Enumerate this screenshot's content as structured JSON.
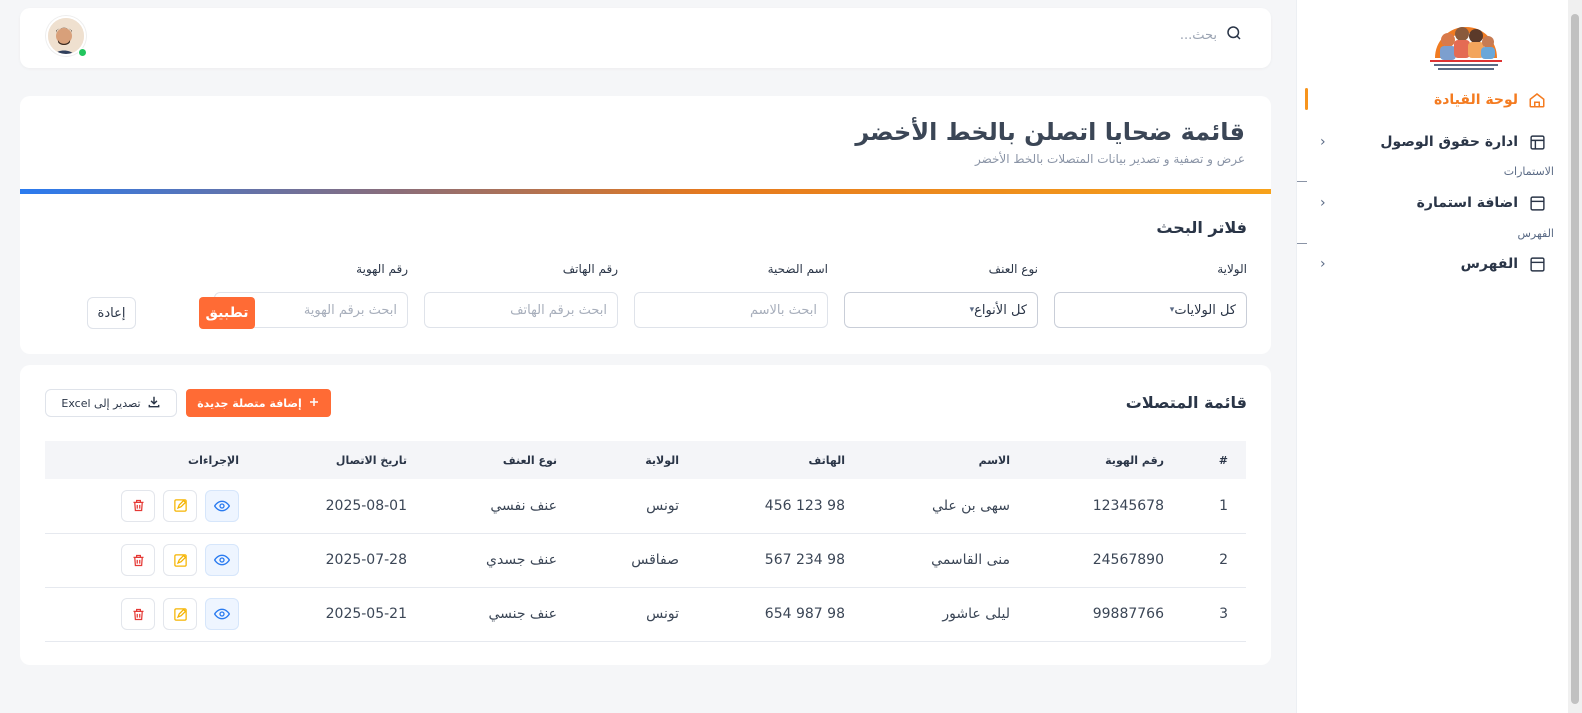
{
  "search": {
    "placeholder": "بحث..."
  },
  "sidebar": {
    "items": [
      {
        "label": "لوحة القيادة"
      },
      {
        "label": "ادارة حقوق الوصول"
      },
      {
        "label": "اضافة استمارة"
      },
      {
        "label": "الفهرس"
      }
    ],
    "captions": [
      "الاستمارات",
      "الفهرس"
    ]
  },
  "header": {
    "title": "قائمة ضحايا اتصلن بالخط الأخضر",
    "subtitle": "عرض و تصفية و تصدير بيانات المتصلات بالخط الأخضر"
  },
  "filters": {
    "title": "فلاتر البحث",
    "labels": {
      "state": "الولاية",
      "violence_type": "نوع العنف",
      "victim_name": "اسم الضحية",
      "phone": "رقم الهاتف",
      "id": "رقم الهوية"
    },
    "values": {
      "state": "كل الولايات",
      "violence_type": "كل الأنواع"
    },
    "placeholders": {
      "victim_name": "ابحث بالاسم",
      "phone": "ابحث برقم الهاتف",
      "id": "ابحث برقم الهوية"
    },
    "apply_label": "تطبيق",
    "reset_label": "إعادة"
  },
  "list": {
    "title": "قائمة المتصلات",
    "add_label": "إضافة متصلة جديدة",
    "export_label": "تصدير إلى Excel",
    "columns": [
      "#",
      "رقم الهوية",
      "الاسم",
      "الهاتف",
      "الولاية",
      "نوع العنف",
      "تاريخ الاتصال",
      "الإجراءات"
    ],
    "rows": [
      {
        "n": "1",
        "id": "12345678",
        "name": "سهى بن علي",
        "phone": "98 123 456",
        "state": "تونس",
        "type": "عنف نفسي",
        "date": "2025-08-01"
      },
      {
        "n": "2",
        "id": "24567890",
        "name": "منى القاسمي",
        "phone": "98 234 567",
        "state": "صفاقس",
        "type": "عنف جسدي",
        "date": "2025-07-28"
      },
      {
        "n": "3",
        "id": "99887766",
        "name": "ليلى عاشور",
        "phone": "98 987 654",
        "state": "تونس",
        "type": "عنف جنسي",
        "date": "2025-05-21"
      }
    ]
  },
  "colors": {
    "accent": "#ff6b35",
    "active_nav": "#f47b20",
    "view_icon": "#2a7bf0",
    "edit_icon": "#f5b400",
    "delete_icon": "#e53935"
  }
}
